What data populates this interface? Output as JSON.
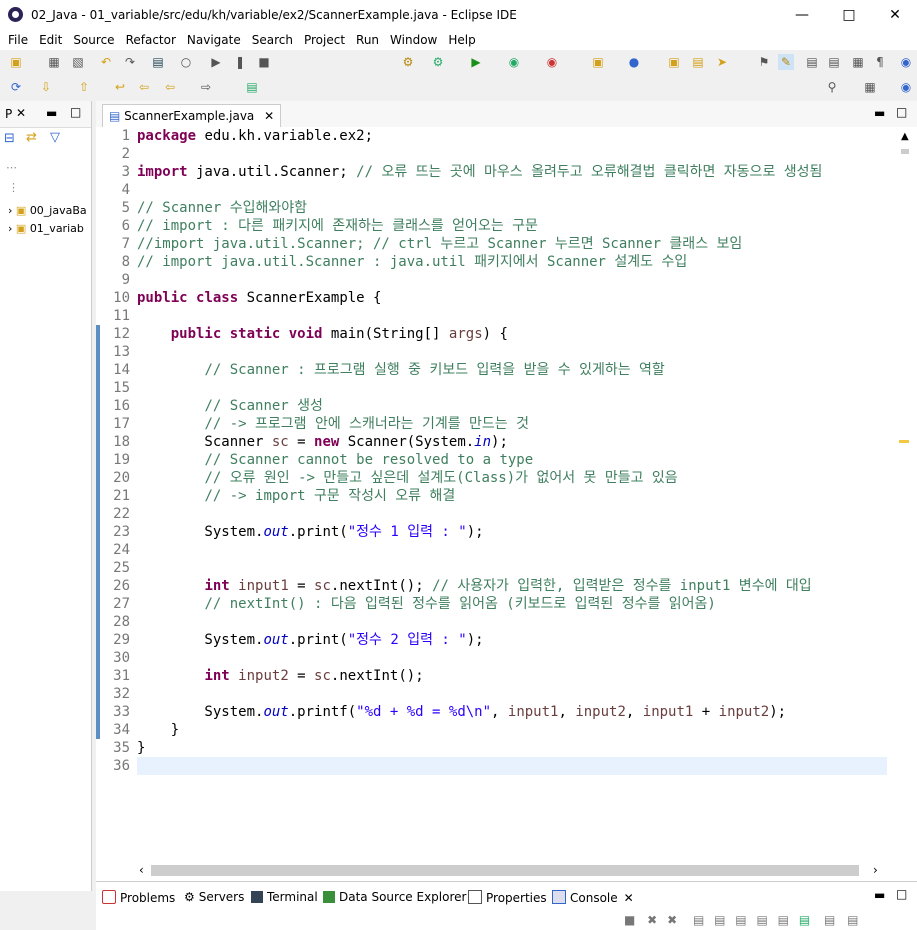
{
  "window": {
    "title": "02_Java - 01_variable/src/edu/kh/variable/ex2/ScannerExample.java - Eclipse IDE"
  },
  "menu": [
    "File",
    "Edit",
    "Source",
    "Refactor",
    "Navigate",
    "Search",
    "Project",
    "Run",
    "Window",
    "Help"
  ],
  "left_panel": {
    "tab_label": "P",
    "items": [
      "00_javaBa",
      "01_variab"
    ]
  },
  "editor": {
    "tab_label": "ScannerExample.java",
    "lines": [
      "package edu.kh.variable.ex2;",
      "",
      "import java.util.Scanner; // 오류 뜨는 곳에 마우스 올려두고 오류해결법 클릭하면 자동으로 생성됨",
      "",
      "// Scanner 수입해와야함",
      "// import : 다른 패키지에 존재하는 클래스를 얻어오는 구문",
      "//import java.util.Scanner; // ctrl 누르고 Scanner 누르면 Scanner 클래스 보임",
      "// import java.util.Scanner : java.util 패키지에서 Scanner 설계도 수입",
      "",
      "public class ScannerExample {",
      "",
      "    public static void main(String[] args) {",
      "",
      "        // Scanner : 프로그램 실행 중 키보드 입력을 받을 수 있게하는 역할",
      "",
      "        // Scanner 생성",
      "        // -> 프로그램 안에 스캐너라는 기계를 만드는 것",
      "        Scanner sc = new Scanner(System.in);",
      "        // Scanner cannot be resolved to a type",
      "        // 오류 원인 -> 만들고 싶은데 설계도(Class)가 없어서 못 만들고 있음",
      "        // -> import 구문 작성시 오류 해결",
      "",
      "        System.out.print(\"정수 1 입력 : \");",
      "",
      "",
      "        int input1 = sc.nextInt(); // 사용자가 입력한, 입력받은 정수를 input1 변수에 대입",
      "        // nextInt() : 다음 입력된 정수를 읽어옴 (키보드로 입력된 정수를 읽어옴)",
      "",
      "        System.out.print(\"정수 2 입력 : \");",
      "",
      "        int input2 = sc.nextInt();",
      "",
      "        System.out.printf(\"%d + %d = %d\\n\", input1, input2, input1 + input2);",
      "    }",
      "}",
      ""
    ]
  },
  "bottom_tabs": [
    "Problems",
    "Servers",
    "Terminal",
    "Data Source Explorer",
    "Properties",
    "Console"
  ],
  "colors": {
    "keyword": "#7f0055",
    "comment": "#3f7f5f",
    "string": "#2a00ff",
    "field": "#0000c0"
  }
}
